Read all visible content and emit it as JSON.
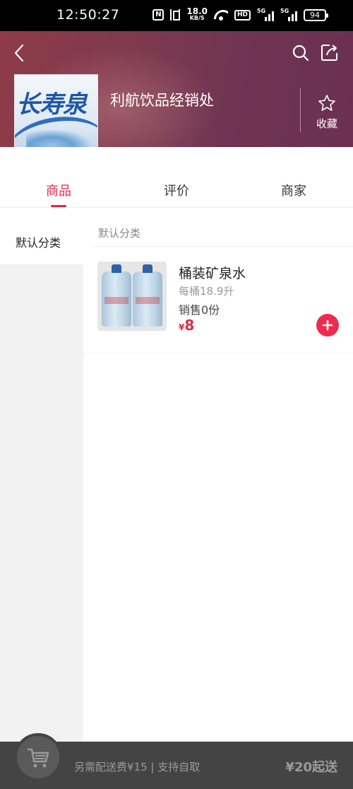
{
  "status_bar": {
    "time": "12:50:27",
    "nfc": "N",
    "net_speed_value": "18.0",
    "net_speed_unit": "KB/S",
    "hd": "HD",
    "sig1": "5G",
    "sig2": "5G",
    "battery": "94"
  },
  "header": {
    "store_name": "利航饮品经销处",
    "logo_text": "长寿泉",
    "favorite_label": "收藏",
    "icons": [
      "back-icon",
      "search-icon",
      "share-icon",
      "star-icon"
    ]
  },
  "tabs": [
    {
      "label": "商品",
      "active": true
    },
    {
      "label": "评价",
      "active": false
    },
    {
      "label": "商家",
      "active": false
    }
  ],
  "sidebar": {
    "categories": [
      {
        "label": "默认分类",
        "selected": true
      }
    ]
  },
  "main": {
    "section_title": "默认分类",
    "products": [
      {
        "name": "桶装矿泉水",
        "spec": "每桶18.9升",
        "sales": "销售0份",
        "currency": "¥",
        "price": "8"
      }
    ]
  },
  "cart": {
    "info": "另需配送费¥15 | 支持自取",
    "min_order": "¥20起送"
  },
  "colors": {
    "accent": "#e0284a",
    "header_bg": "#7f3a4e",
    "cart_bar": "#444444"
  }
}
